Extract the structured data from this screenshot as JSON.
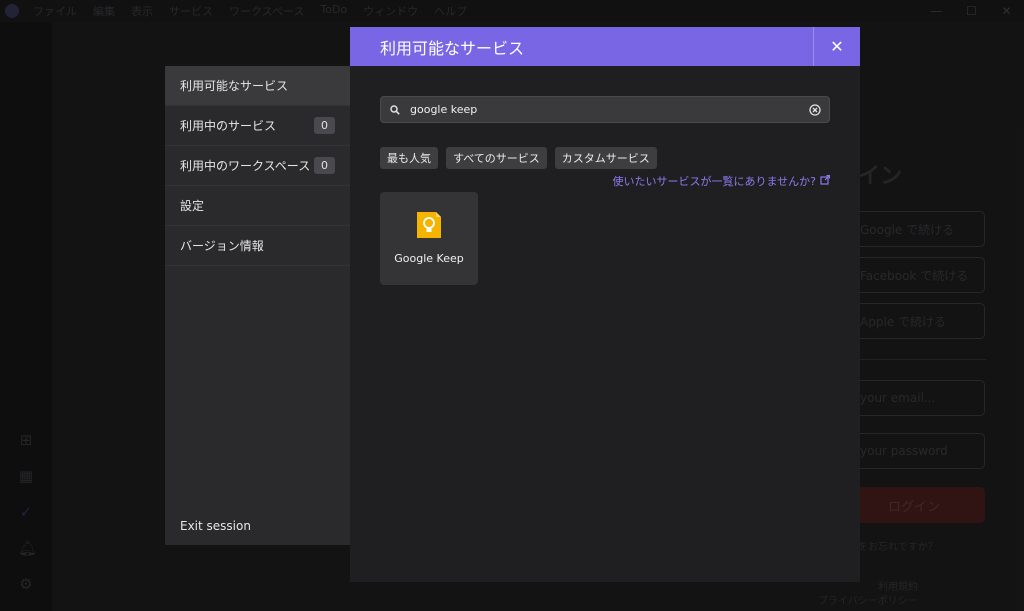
{
  "window": {
    "menu": [
      "ファイル",
      "編集",
      "表示",
      "サービス",
      "ワークスペース",
      "ToDo",
      "ウィンドウ",
      "ヘルプ"
    ],
    "controls": [
      "—",
      "☐",
      "✕"
    ]
  },
  "background_login": {
    "title": "イン",
    "google_button": "Google で続ける",
    "facebook_button": "Facebook で続ける",
    "apple_button": "Apple で続ける",
    "email_placeholder": "your email...",
    "password_placeholder": "your password",
    "login_button": "ログイン",
    "forgot_link": "をお忘れですか？",
    "terms_text": "利用規約",
    "privacy_text": "プライバシーポリシー"
  },
  "sidebar": {
    "items": [
      {
        "label": "利用可能なサービス",
        "badge": null
      },
      {
        "label": "利用中のサービス",
        "badge": "0"
      },
      {
        "label": "利用中のワークスペース",
        "badge": "0"
      },
      {
        "label": "設定",
        "badge": null
      },
      {
        "label": "バージョン情報",
        "badge": null
      }
    ],
    "exit_label": "Exit session"
  },
  "modal": {
    "title": "利用可能なサービス",
    "close_glyph": "✕",
    "search_value": "google keep",
    "filters": [
      "最も人気",
      "すべてのサービス",
      "カスタムサービス"
    ],
    "missing_link": "使いたいサービスが一覧にありませんか?",
    "results": [
      {
        "name": "Google Keep",
        "icon": "google-keep-icon"
      }
    ]
  },
  "colors": {
    "accent": "#7866e4",
    "link": "#8b7bf0",
    "keep_yellow": "#f4b400"
  }
}
